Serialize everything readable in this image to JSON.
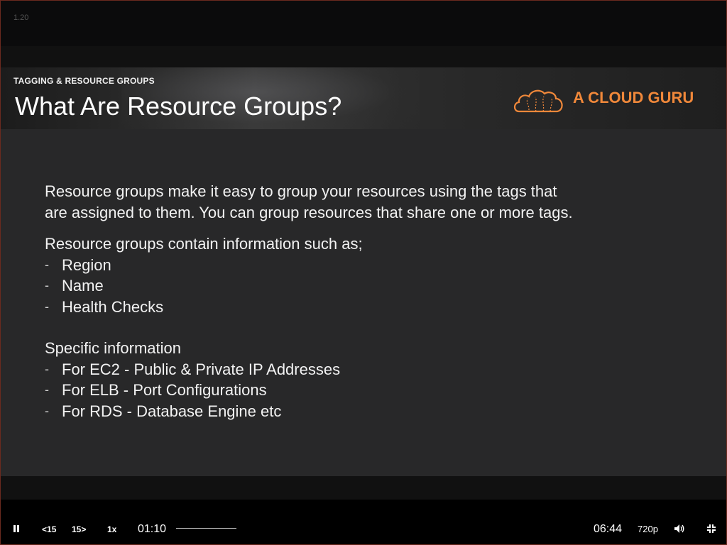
{
  "player": {
    "lesson_number": "1.20",
    "current_time": "01:10",
    "total_time": "06:44",
    "quality": "720p",
    "speed": "1x",
    "skip_back_label": "15",
    "skip_forward_label": "15",
    "progress_fraction": 0.17
  },
  "slide": {
    "section": "TAGGING & RESOURCE GROUPS",
    "title": "What Are Resource Groups?",
    "brand": "A CLOUD GURU",
    "brand_color": "#f0883a",
    "intro_line1": "Resource groups make it easy to group your resources using the tags that",
    "intro_line2": "are assigned to them. You can group resources that share one or more tags.",
    "contain_heading": "Resource groups contain information such as;",
    "contain_items": [
      "Region",
      "Name",
      "Health Checks"
    ],
    "specific_heading": "Specific information",
    "specific_items": [
      "For EC2 - Public & Private IP Addresses",
      "For ELB - Port Configurations",
      "For RDS - Database Engine etc"
    ],
    "bullet_marker": "-"
  }
}
